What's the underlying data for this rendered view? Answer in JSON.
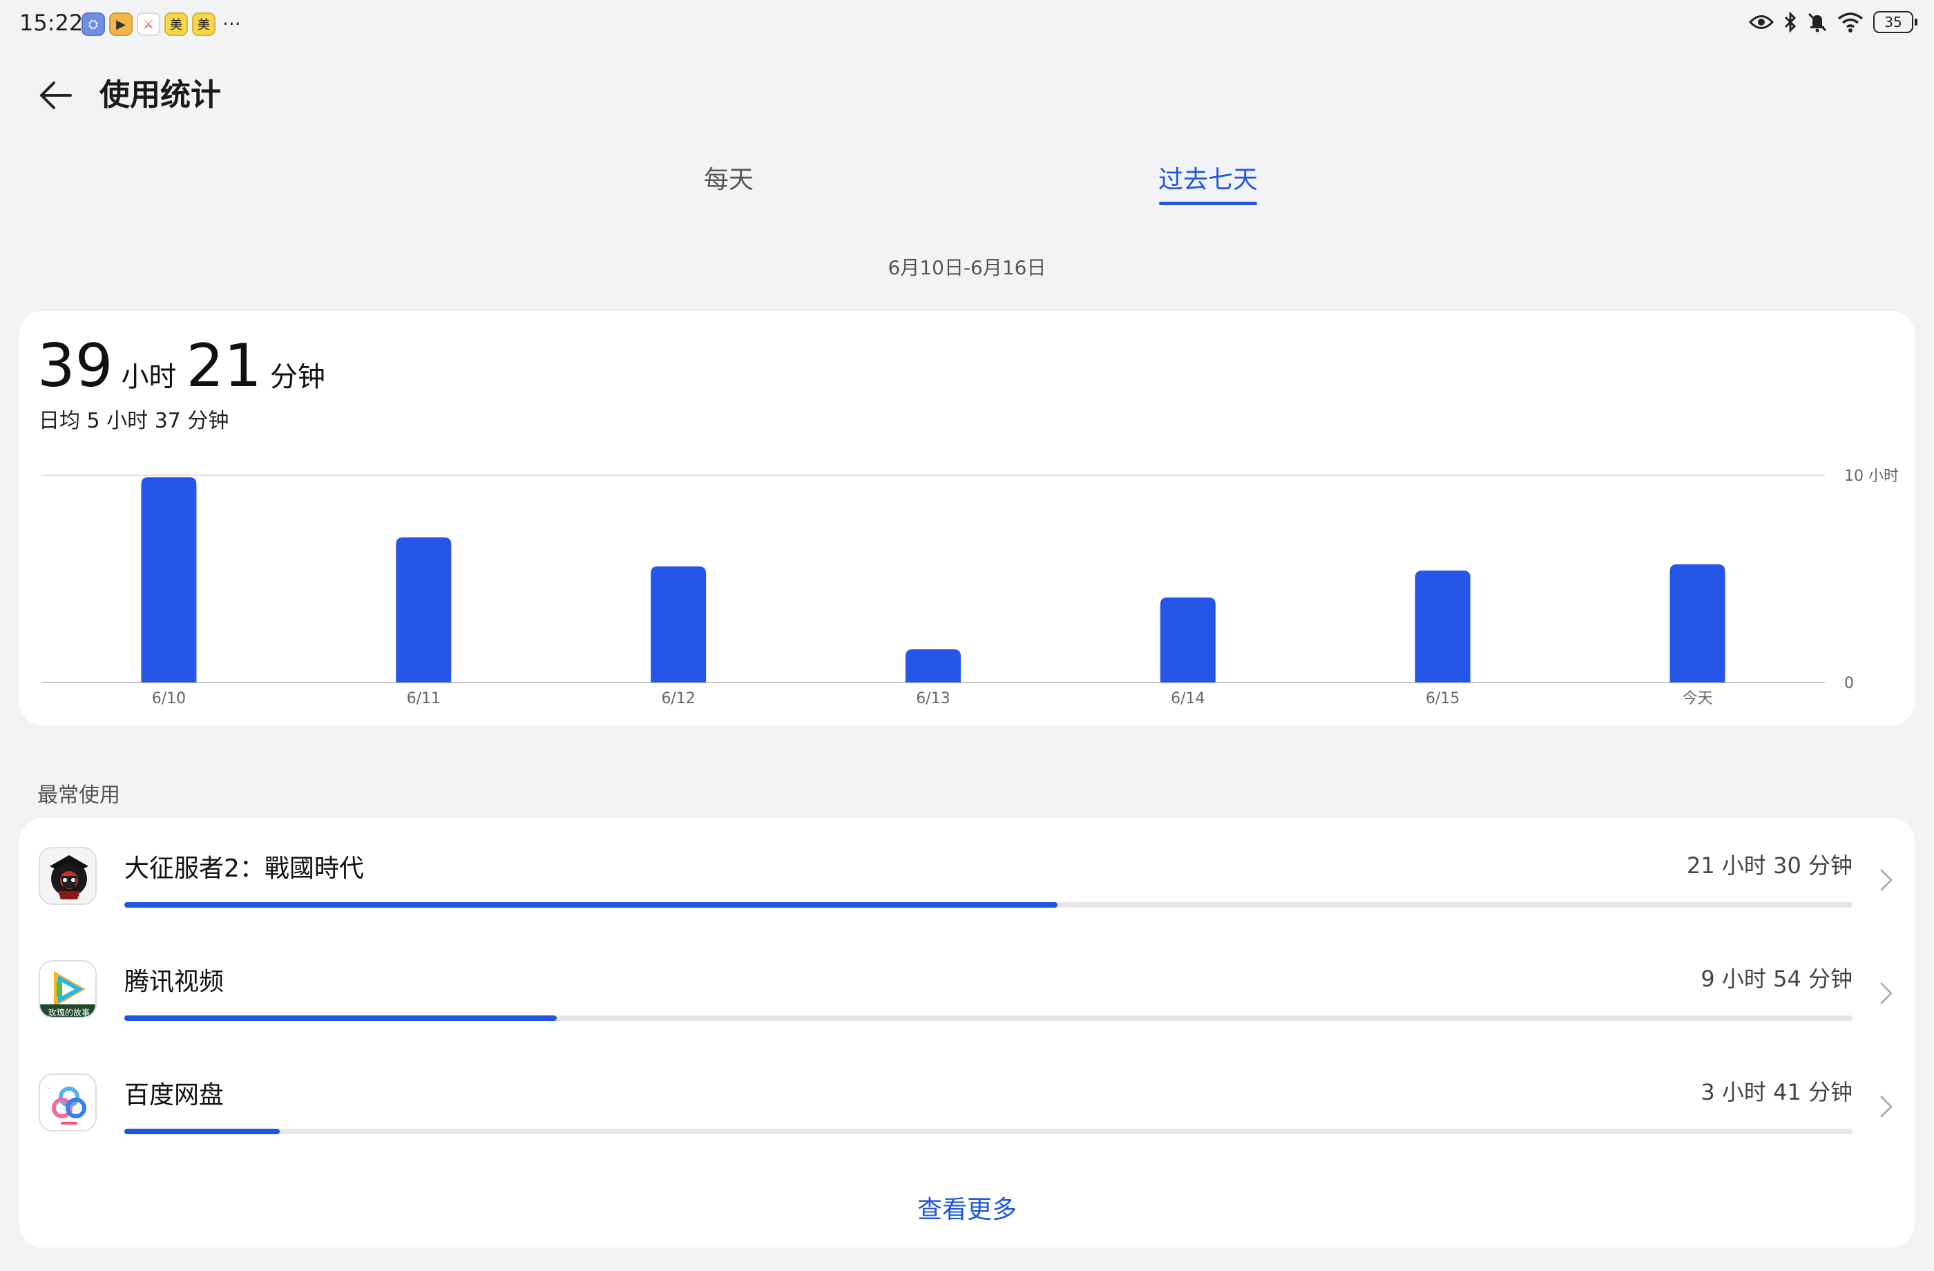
{
  "status_bar": {
    "time": "15:22",
    "notifications": [
      {
        "icon": "weather-app-icon",
        "glyph": "⛭",
        "style": "blue"
      },
      {
        "icon": "video-app-icon",
        "glyph": "▶",
        "style": "orange"
      },
      {
        "icon": "game-app-icon",
        "glyph": "⚔",
        "style": "white"
      },
      {
        "icon": "meituan-app-icon",
        "glyph": "美",
        "style": "yellow"
      },
      {
        "icon": "meituan-app-icon",
        "glyph": "美",
        "style": "yellow"
      }
    ],
    "more": "···",
    "battery": "35"
  },
  "header": {
    "title": "使用统计"
  },
  "tabs": [
    {
      "label": "每天",
      "active": false
    },
    {
      "label": "过去七天",
      "active": true
    }
  ],
  "date_range": "6月10日-6月16日",
  "summary": {
    "hours": "39",
    "hours_unit": "小时",
    "minutes": "21",
    "minutes_unit": "分钟",
    "daily_average": "日均 5 小时 37 分钟"
  },
  "chart_data": {
    "type": "bar",
    "categories": [
      "6/10",
      "6/11",
      "6/12",
      "6/13",
      "6/14",
      "6/15",
      "今天"
    ],
    "values": [
      9.9,
      7.0,
      5.6,
      1.6,
      4.1,
      5.4,
      5.7
    ],
    "ylim": [
      0,
      10
    ],
    "y_ticks": [
      "0",
      "10 小时"
    ],
    "colors": {
      "bar": "#2556e8",
      "grid": "#e2e2e2",
      "axis": "#c8c8c8"
    }
  },
  "most_used": {
    "title": "最常使用",
    "apps": [
      {
        "name": "大征服者2：戰國時代",
        "time": "21 小时 30 分钟",
        "fraction": 0.54,
        "icon": "samurai-game-icon"
      },
      {
        "name": "腾讯视频",
        "time": "9 小时 54 分钟",
        "fraction": 0.25,
        "icon": "tencent-video-icon",
        "icon_caption": "玫瑰的故事"
      },
      {
        "name": "百度网盘",
        "time": "3 小时 41 分钟",
        "fraction": 0.09,
        "icon": "baidu-netdisk-icon"
      }
    ],
    "see_more": "查看更多"
  },
  "colors": {
    "accent": "#1e56e0",
    "background": "#f1f3f5",
    "card": "#ffffff"
  }
}
